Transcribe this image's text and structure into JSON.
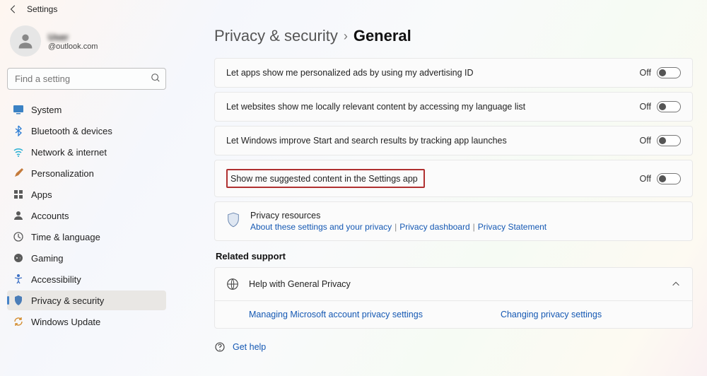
{
  "window": {
    "title": "Settings"
  },
  "user": {
    "name": "User",
    "email": "@outlook.com"
  },
  "search": {
    "placeholder": "Find a setting"
  },
  "nav": {
    "items": [
      {
        "label": "System"
      },
      {
        "label": "Bluetooth & devices"
      },
      {
        "label": "Network & internet"
      },
      {
        "label": "Personalization"
      },
      {
        "label": "Apps"
      },
      {
        "label": "Accounts"
      },
      {
        "label": "Time & language"
      },
      {
        "label": "Gaming"
      },
      {
        "label": "Accessibility"
      },
      {
        "label": "Privacy & security"
      },
      {
        "label": "Windows Update"
      }
    ]
  },
  "breadcrumb": {
    "parent": "Privacy & security",
    "current": "General"
  },
  "settings": [
    {
      "label": "Let apps show me personalized ads by using my advertising ID",
      "state": "Off"
    },
    {
      "label": "Let websites show me locally relevant content by accessing my language list",
      "state": "Off"
    },
    {
      "label": "Let Windows improve Start and search results by tracking app launches",
      "state": "Off"
    },
    {
      "label": "Show me suggested content in the Settings app",
      "state": "Off"
    }
  ],
  "resources": {
    "title": "Privacy resources",
    "links": [
      "About these settings and your privacy",
      "Privacy dashboard",
      "Privacy Statement"
    ]
  },
  "related": {
    "heading": "Related support",
    "expander_title": "Help with General Privacy",
    "links": [
      "Managing Microsoft account privacy settings",
      "Changing privacy settings"
    ]
  },
  "help": {
    "label": "Get help"
  }
}
